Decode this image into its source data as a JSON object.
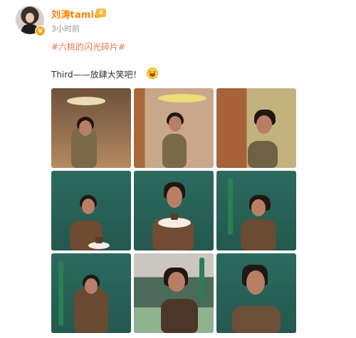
{
  "post": {
    "username": "刘涛tamia",
    "time": "3小时前",
    "topic": "#六桃的闪光碎片#",
    "text": "Third——放肆大笑吧！"
  },
  "photos": [
    {
      "name": "photo-1"
    },
    {
      "name": "photo-2"
    },
    {
      "name": "photo-3"
    },
    {
      "name": "photo-4"
    },
    {
      "name": "photo-5"
    },
    {
      "name": "photo-6"
    },
    {
      "name": "photo-7"
    },
    {
      "name": "photo-8"
    },
    {
      "name": "photo-9"
    }
  ]
}
